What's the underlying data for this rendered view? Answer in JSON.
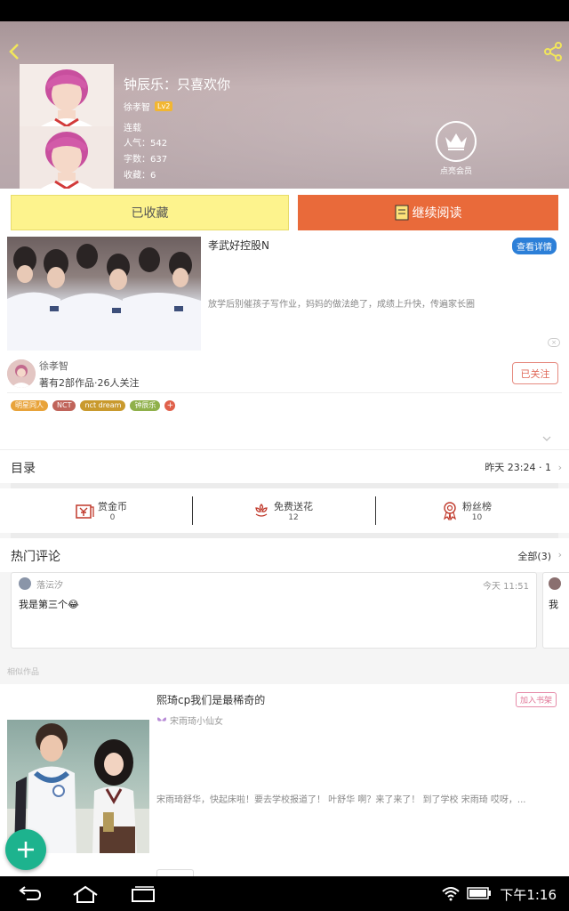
{
  "book": {
    "title": "钟辰乐：只喜欢你",
    "author": "徐孝智",
    "author_level": "Lv2",
    "status": "连载",
    "popularity": "人气：542",
    "word_count": "字数：637",
    "favorites": "收藏：6"
  },
  "vip": {
    "label": "点亮会员"
  },
  "actions": {
    "collected_label": "已收藏",
    "read_label": "继续阅读"
  },
  "ad": {
    "title": "孝武好控股N",
    "detail_label": "查看详情",
    "description": "放学后别催孩子写作业，妈妈的做法绝了，成绩上升快，传遍家长圈",
    "close_label": "×"
  },
  "author_section": {
    "name": "徐孝智",
    "stats": "著有2部作品·26人关注",
    "follow_label": "已关注",
    "tags": [
      {
        "label": "明星同人",
        "color": "#e8a33a"
      },
      {
        "label": "NCT",
        "color": "#c0645a"
      },
      {
        "label": "nct dream",
        "color": "#c99a2e"
      },
      {
        "label": "钟辰乐",
        "color": "#8fb04a"
      }
    ],
    "tag_more": "+"
  },
  "toc": {
    "label": "目录",
    "latest": "昨天 23:24 · 1"
  },
  "stats": [
    {
      "label": "赏金币",
      "value": "0",
      "icon": "reward-coin-icon"
    },
    {
      "label": "免费送花",
      "value": "12",
      "icon": "flower-icon"
    },
    {
      "label": "粉丝榜",
      "value": "10",
      "icon": "medal-icon"
    }
  ],
  "comments": {
    "title": "热门评论",
    "all_label": "全部(3)",
    "items": [
      {
        "user": "落沄汐",
        "time": "今天 11:51",
        "text": "我是第三个😂"
      },
      {
        "text": "我"
      }
    ]
  },
  "similar": {
    "label": "相似作品",
    "item": {
      "title": "熙琦cp我们是最稀奇的",
      "author": "宋雨琦小仙女",
      "add_label": "加入书架",
      "description": "宋雨琦舒华，快起床啦！要去学校报道了！ 叶舒华 啊？来了来了！ 到了学校 宋雨琦 哎呀，..."
    }
  },
  "system": {
    "clock": "下午1:16"
  },
  "colors": {
    "accent": "#e96a3a",
    "collected_bg": "#fdf38d",
    "fab": "#1db38e"
  }
}
